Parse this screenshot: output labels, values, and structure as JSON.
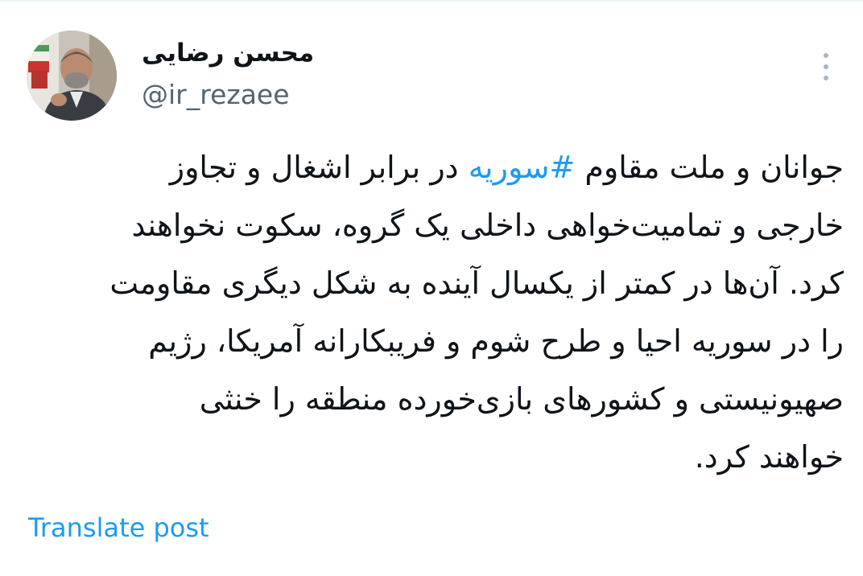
{
  "author": {
    "display_name": "محسن رضایی",
    "handle": "@ir_rezaee"
  },
  "post": {
    "line1_before": "جوانان و ملت مقاوم ",
    "hashtag": "#سوریه",
    "line1_after": " در برابر اشغال و تجاوز",
    "line2": "خارجی و تمامیت‌خواهی داخلی یک گروه، سکوت نخواهند",
    "line3": "کرد. آن‌ها در کمتر از یکسال آینده به شکل دیگری مقاومت",
    "line4": "را در سوریه احیا و طرح شوم و فریبکارانه آمریکا، رژیم",
    "line5": "صهیونیستی و کشورهای بازی‌خورده منطقه را خنثی",
    "line6": "خواهند کرد."
  },
  "actions": {
    "translate_label": "Translate post",
    "more_icon": "more-vertical-icon"
  },
  "colors": {
    "accent": "#1d9bf0",
    "text": "#0f1419",
    "secondary_text": "#536471",
    "icon": "#a7b6c2"
  }
}
